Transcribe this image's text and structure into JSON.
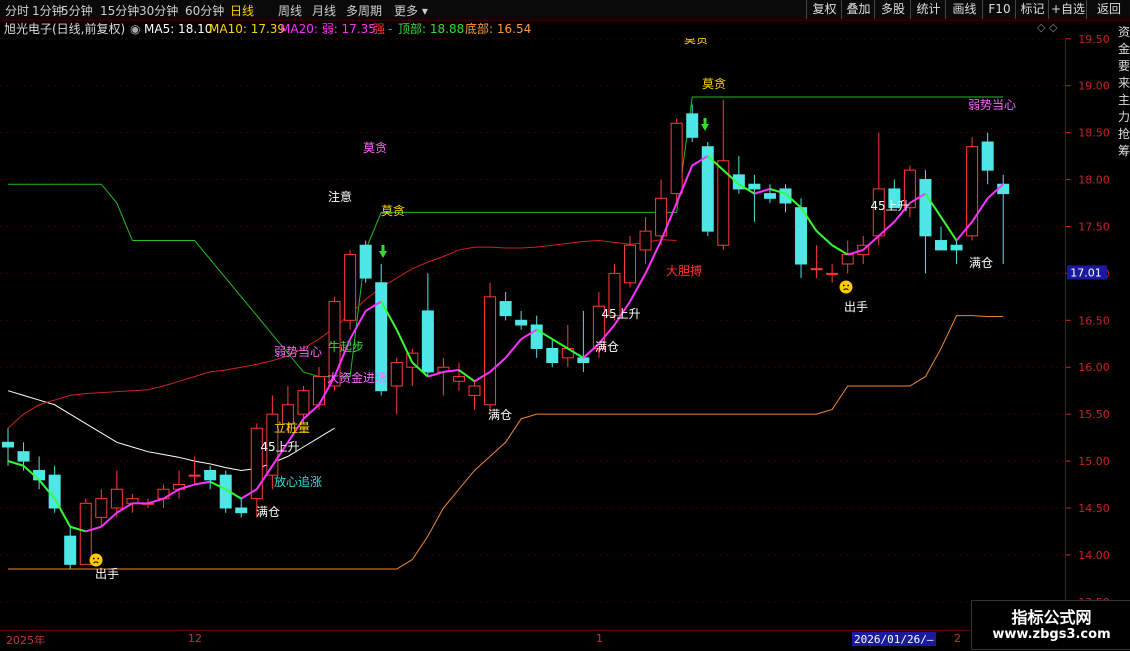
{
  "toolbar": {
    "tabs": [
      {
        "label": "分时",
        "active": false
      },
      {
        "label": "1分钟",
        "active": false
      },
      {
        "label": "5分钟",
        "active": false
      },
      {
        "label": "15分钟",
        "active": false
      },
      {
        "label": "30分钟",
        "active": false
      },
      {
        "label": "60分钟",
        "active": false
      },
      {
        "label": "日线",
        "active": true
      },
      {
        "label": "周线",
        "active": false
      },
      {
        "label": "月线",
        "active": false
      },
      {
        "label": "多周期",
        "active": false
      },
      {
        "label": "更多",
        "active": false
      }
    ],
    "right_buttons": [
      "复权",
      "叠加",
      "多股",
      "统计",
      "画线",
      "F10",
      "标记",
      "+自选",
      "返回"
    ]
  },
  "info": {
    "stock_title": "旭光电子(日线,前复权)",
    "ma5": "MA5: 18.10",
    "ma10": "MA10: 17.39",
    "ma20": "MA20: 弱: 17.35",
    "strong": "强",
    "dash": "-",
    "top": "顶部: 18.88",
    "bottom": "底部: 16.54",
    "colors": {
      "ma5": "#ffffff",
      "ma10": "#ffd400",
      "ma20": "#ff33ff",
      "strong": "#ff3333",
      "top": "#33dd33",
      "bottom": "#ff9933"
    }
  },
  "axis": {
    "ticks": [
      "19.50",
      "19.00",
      "18.50",
      "18.00",
      "17.50",
      "17.00",
      "16.50",
      "16.00",
      "15.50",
      "15.00",
      "14.50",
      "14.00",
      "13.50"
    ],
    "current_price": "17.01"
  },
  "dates": {
    "labels": [
      "2025年",
      "12",
      "1",
      "2"
    ],
    "cursor_date": "2026/01/26/—"
  },
  "annotations": [
    {
      "text": "莫贪",
      "color": "#ffd400"
    },
    {
      "text": "莫贪",
      "color": "#ff66ff"
    },
    {
      "text": "注意",
      "color": "#ffffff"
    },
    {
      "text": "莫贪",
      "color": "#ffd400"
    },
    {
      "text": "莫贪",
      "color": "#ffd400"
    },
    {
      "text": "弱势当心",
      "color": "#ff66ff"
    },
    {
      "text": "弱势当心",
      "color": "#ff66ff"
    },
    {
      "text": "牛起步",
      "color": "#33dd33"
    },
    {
      "text": "大资金进场",
      "color": "#ff66ff"
    },
    {
      "text": "立桩量",
      "color": "#ffd400"
    },
    {
      "text": "45上升",
      "color": "#ffffff"
    },
    {
      "text": "放心追涨",
      "color": "#33dddd"
    },
    {
      "text": "满仓",
      "color": "#ffffff"
    },
    {
      "text": "出手",
      "color": "#ffffff"
    },
    {
      "text": "满仓",
      "color": "#ffffff"
    },
    {
      "text": "45上升",
      "color": "#ffffff"
    },
    {
      "text": "满仓",
      "color": "#ffffff"
    },
    {
      "text": "大胆搏",
      "color": "#ff3333"
    },
    {
      "text": "出手",
      "color": "#ffffff"
    },
    {
      "text": "45上升",
      "color": "#ffffff"
    },
    {
      "text": "满仓",
      "color": "#ffffff"
    }
  ],
  "side_text": "资金要来主力抢筹",
  "watermark": {
    "line1": "指标公式网",
    "line2": "www.zbgs3.com"
  },
  "chart_data": {
    "type": "candlestick",
    "ylim": [
      13.2,
      19.7
    ],
    "candles": [
      {
        "o": 15.2,
        "h": 15.35,
        "l": 14.95,
        "c": 15.15
      },
      {
        "o": 15.1,
        "h": 15.2,
        "l": 14.9,
        "c": 15.0
      },
      {
        "o": 14.9,
        "h": 15.05,
        "l": 14.7,
        "c": 14.8
      },
      {
        "o": 14.85,
        "h": 14.95,
        "l": 14.45,
        "c": 14.5
      },
      {
        "o": 14.2,
        "h": 14.3,
        "l": 13.85,
        "c": 13.9
      },
      {
        "o": 13.9,
        "h": 14.6,
        "l": 13.9,
        "c": 14.55
      },
      {
        "o": 14.4,
        "h": 14.7,
        "l": 14.3,
        "c": 14.6
      },
      {
        "o": 14.5,
        "h": 14.9,
        "l": 14.4,
        "c": 14.7
      },
      {
        "o": 14.55,
        "h": 14.65,
        "l": 14.45,
        "c": 14.6
      },
      {
        "o": 14.55,
        "h": 14.6,
        "l": 14.5,
        "c": 14.55
      },
      {
        "o": 14.6,
        "h": 14.75,
        "l": 14.5,
        "c": 14.7
      },
      {
        "o": 14.7,
        "h": 14.9,
        "l": 14.6,
        "c": 14.75
      },
      {
        "o": 14.85,
        "h": 15.05,
        "l": 14.75,
        "c": 14.85
      },
      {
        "o": 14.9,
        "h": 14.95,
        "l": 14.7,
        "c": 14.8
      },
      {
        "o": 14.85,
        "h": 14.9,
        "l": 14.45,
        "c": 14.5
      },
      {
        "o": 14.5,
        "h": 14.6,
        "l": 14.4,
        "c": 14.45
      },
      {
        "o": 14.6,
        "h": 15.4,
        "l": 14.4,
        "c": 15.35
      },
      {
        "o": 14.85,
        "h": 15.7,
        "l": 14.7,
        "c": 15.5
      },
      {
        "o": 15.4,
        "h": 15.8,
        "l": 15.3,
        "c": 15.6
      },
      {
        "o": 15.5,
        "h": 15.8,
        "l": 15.4,
        "c": 15.75
      },
      {
        "o": 15.6,
        "h": 16.0,
        "l": 15.55,
        "c": 15.9
      },
      {
        "o": 15.8,
        "h": 16.75,
        "l": 15.75,
        "c": 16.7
      },
      {
        "o": 16.5,
        "h": 17.25,
        "l": 16.4,
        "c": 17.2
      },
      {
        "o": 17.3,
        "h": 17.35,
        "l": 16.9,
        "c": 16.95
      },
      {
        "o": 16.9,
        "h": 17.1,
        "l": 15.7,
        "c": 15.75
      },
      {
        "o": 15.8,
        "h": 16.1,
        "l": 15.5,
        "c": 16.05
      },
      {
        "o": 16.0,
        "h": 16.2,
        "l": 15.8,
        "c": 16.15
      },
      {
        "o": 16.6,
        "h": 17.0,
        "l": 15.9,
        "c": 15.95
      },
      {
        "o": 15.95,
        "h": 16.1,
        "l": 15.7,
        "c": 16.0
      },
      {
        "o": 15.85,
        "h": 16.05,
        "l": 15.75,
        "c": 15.9
      },
      {
        "o": 15.7,
        "h": 15.85,
        "l": 15.55,
        "c": 15.8
      },
      {
        "o": 15.6,
        "h": 16.9,
        "l": 15.5,
        "c": 16.75
      },
      {
        "o": 16.7,
        "h": 16.8,
        "l": 16.5,
        "c": 16.55
      },
      {
        "o": 16.5,
        "h": 16.6,
        "l": 16.4,
        "c": 16.45
      },
      {
        "o": 16.45,
        "h": 16.55,
        "l": 16.1,
        "c": 16.2
      },
      {
        "o": 16.2,
        "h": 16.3,
        "l": 16.0,
        "c": 16.05
      },
      {
        "o": 16.1,
        "h": 16.45,
        "l": 16.0,
        "c": 16.2
      },
      {
        "o": 16.1,
        "h": 16.6,
        "l": 15.95,
        "c": 16.05
      },
      {
        "o": 16.2,
        "h": 16.8,
        "l": 16.1,
        "c": 16.65
      },
      {
        "o": 16.55,
        "h": 17.1,
        "l": 16.5,
        "c": 17.0
      },
      {
        "o": 16.9,
        "h": 17.4,
        "l": 16.85,
        "c": 17.3
      },
      {
        "o": 17.25,
        "h": 17.6,
        "l": 17.1,
        "c": 17.45
      },
      {
        "o": 17.4,
        "h": 18.0,
        "l": 17.3,
        "c": 17.8
      },
      {
        "o": 17.85,
        "h": 18.65,
        "l": 17.75,
        "c": 18.6
      },
      {
        "o": 18.7,
        "h": 18.8,
        "l": 18.4,
        "c": 18.45
      },
      {
        "o": 18.35,
        "h": 18.4,
        "l": 17.4,
        "c": 17.45
      },
      {
        "o": 17.3,
        "h": 18.85,
        "l": 17.25,
        "c": 18.2
      },
      {
        "o": 18.05,
        "h": 18.25,
        "l": 17.85,
        "c": 17.9
      },
      {
        "o": 17.95,
        "h": 18.05,
        "l": 17.55,
        "c": 17.9
      },
      {
        "o": 17.85,
        "h": 17.95,
        "l": 17.75,
        "c": 17.8
      },
      {
        "o": 17.9,
        "h": 17.95,
        "l": 17.65,
        "c": 17.75
      },
      {
        "o": 17.7,
        "h": 17.8,
        "l": 16.95,
        "c": 17.1
      },
      {
        "o": 17.05,
        "h": 17.3,
        "l": 16.95,
        "c": 17.05
      },
      {
        "o": 17.0,
        "h": 17.1,
        "l": 16.9,
        "c": 17.0
      },
      {
        "o": 17.1,
        "h": 17.35,
        "l": 17.0,
        "c": 17.2
      },
      {
        "o": 17.2,
        "h": 17.4,
        "l": 17.1,
        "c": 17.3
      },
      {
        "o": 17.4,
        "h": 18.5,
        "l": 17.3,
        "c": 17.9
      },
      {
        "o": 17.9,
        "h": 18.0,
        "l": 17.7,
        "c": 17.7
      },
      {
        "o": 17.7,
        "h": 18.15,
        "l": 17.6,
        "c": 18.1
      },
      {
        "o": 18.0,
        "h": 18.1,
        "l": 17.0,
        "c": 17.4
      },
      {
        "o": 17.35,
        "h": 17.5,
        "l": 17.25,
        "c": 17.25
      },
      {
        "o": 17.3,
        "h": 17.35,
        "l": 17.1,
        "c": 17.25
      },
      {
        "o": 17.4,
        "h": 18.45,
        "l": 17.35,
        "c": 18.35
      },
      {
        "o": 18.4,
        "h": 18.5,
        "l": 17.95,
        "c": 18.1
      },
      {
        "o": 17.95,
        "h": 18.05,
        "l": 17.1,
        "c": 17.85
      }
    ],
    "ma_short": [
      15.0,
      14.95,
      14.8,
      14.6,
      14.3,
      14.25,
      14.3,
      14.45,
      14.55,
      14.55,
      14.6,
      14.7,
      14.75,
      14.78,
      14.7,
      14.6,
      14.7,
      14.95,
      15.2,
      15.45,
      15.6,
      15.9,
      16.3,
      16.6,
      16.7,
      16.4,
      16.05,
      15.9,
      15.95,
      15.97,
      15.85,
      15.95,
      16.1,
      16.3,
      16.4,
      16.3,
      16.2,
      16.1,
      16.25,
      16.45,
      16.7,
      17.0,
      17.35,
      17.75,
      18.15,
      18.25,
      18.1,
      17.95,
      17.85,
      17.9,
      17.85,
      17.7,
      17.45,
      17.3,
      17.2,
      17.25,
      17.4,
      17.55,
      17.75,
      17.85,
      17.6,
      17.35,
      17.55,
      17.8,
      17.95
    ],
    "ma_long": [
      15.75,
      15.7,
      15.65,
      15.6,
      15.5,
      15.4,
      15.3,
      15.2,
      15.15,
      15.1,
      15.07,
      15.04,
      15.0,
      14.97,
      14.93,
      14.9,
      14.92,
      14.98,
      15.05,
      15.15,
      15.25,
      15.35,
      15.5,
      15.6,
      15.65,
      15.7,
      15.72,
      15.73,
      15.74,
      15.75,
      15.76,
      15.8,
      15.85,
      15.9,
      15.95,
      15.97,
      16.0,
      16.03,
      16.07,
      16.12,
      16.2,
      16.3,
      16.42,
      16.57,
      16.72,
      16.85,
      16.95,
      17.05,
      17.12,
      17.18,
      17.25,
      17.28,
      17.28,
      17.27,
      17.27,
      17.28,
      17.3,
      17.32,
      17.34,
      17.35,
      17.33,
      17.31,
      17.33,
      17.36,
      17.35
    ],
    "top_line": [
      17.95,
      17.95,
      17.95,
      17.95,
      17.95,
      17.95,
      17.95,
      17.75,
      17.35,
      17.35,
      17.35,
      17.35,
      17.35,
      17.15,
      16.95,
      16.75,
      16.55,
      16.35,
      16.15,
      15.95,
      15.9,
      15.9,
      15.9,
      17.25,
      17.65,
      17.65,
      17.65,
      17.65,
      17.65,
      17.65,
      17.65,
      17.65,
      17.65,
      17.65,
      17.65,
      17.65,
      17.65,
      17.65,
      17.65,
      17.65,
      17.65,
      17.65,
      17.65,
      17.65,
      18.88,
      18.88,
      18.88,
      18.88,
      18.88,
      18.88,
      18.88,
      18.88,
      18.88,
      18.88,
      18.88,
      18.88,
      18.88,
      18.88,
      18.88,
      18.88,
      18.88,
      18.88,
      18.88,
      18.88,
      18.88
    ],
    "bottom_line": [
      13.85,
      13.85,
      13.85,
      13.85,
      13.85,
      13.85,
      13.85,
      13.85,
      13.85,
      13.85,
      13.85,
      13.85,
      13.85,
      13.85,
      13.85,
      13.85,
      13.85,
      13.85,
      13.85,
      13.85,
      13.85,
      13.85,
      13.85,
      13.85,
      13.85,
      13.85,
      13.95,
      14.2,
      14.5,
      14.7,
      14.9,
      15.05,
      15.2,
      15.45,
      15.5,
      15.5,
      15.5,
      15.5,
      15.5,
      15.5,
      15.5,
      15.5,
      15.5,
      15.5,
      15.5,
      15.5,
      15.5,
      15.5,
      15.5,
      15.5,
      15.5,
      15.5,
      15.5,
      15.55,
      15.8,
      15.8,
      15.8,
      15.8,
      15.8,
      15.9,
      16.2,
      16.55,
      16.55,
      16.54,
      16.54
    ]
  }
}
